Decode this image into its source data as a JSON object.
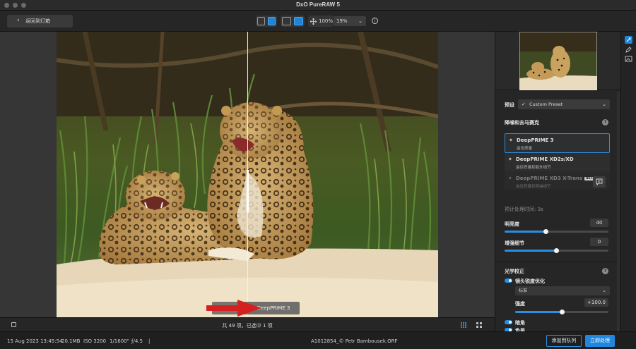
{
  "window": {
    "title": "DxO PureRAW 5"
  },
  "toolbar": {
    "back_label": "返回到灯箱",
    "zoom_fit": "100%",
    "zoom_level": "19%"
  },
  "viewer": {
    "after_label": "DeepPRIME 3",
    "selection_count": "共 49 项，已选中 1 项"
  },
  "panel": {
    "preset_label": "预设",
    "preset_value": "Custom Preset",
    "denoise_title": "降噪和去马赛克",
    "help": "?",
    "options": [
      {
        "name": "DeepPRIME 3",
        "sub": "最佳质量",
        "selected": true,
        "disabled": false
      },
      {
        "name": "DeepPRIME XD2s/XD",
        "sub": "最佳质量和额外细节",
        "selected": false,
        "disabled": false
      },
      {
        "name": "DeepPRIME XD3 X-Trans",
        "sub": "最佳质量和降噪细节",
        "selected": false,
        "disabled": true,
        "badge": "BETA"
      }
    ],
    "est_time": "预计处理时间: 3s",
    "luminance_label": "明亮度",
    "luminance_value": "40",
    "luminance_level": 0.4,
    "detail_label": "增强细节",
    "detail_value": "0",
    "detail_level": 0.5,
    "optics_title": "光学校正",
    "lens_sharpness_label": "镜头锐度优化",
    "lens_mode": "标准",
    "strength_label": "强度",
    "strength_value": "+100.0",
    "strength_level": 0.5,
    "vignetting_label": "暗角",
    "chromatic_label": "色差"
  },
  "status": {
    "date": "15 Aug 2023 13:45:54",
    "size": "20.1MB",
    "iso": "ISO 3200",
    "shutter": "1/1600\"",
    "aperture": "ƒ/4.5",
    "sep": "|",
    "filename": "A1012854_© Petr Bambousek.ORF",
    "add_queue": "添加到队列",
    "process_now": "立即处理"
  },
  "colors": {
    "accent": "#1f87e0",
    "panel_bg": "#262626"
  }
}
